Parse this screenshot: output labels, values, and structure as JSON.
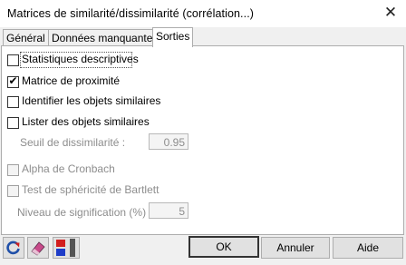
{
  "window": {
    "title": "Matrices de similarité/dissimilarité (corrélation...)",
    "close_glyph": "✕"
  },
  "tabs": [
    {
      "label": "Général",
      "active": false
    },
    {
      "label": "Données manquantes",
      "active": false
    },
    {
      "label": "Sorties",
      "active": true
    }
  ],
  "options": {
    "stats_desc": {
      "label": "Statistiques descriptives",
      "checked": false
    },
    "prox_matrix": {
      "label": "Matrice de proximité",
      "checked": true
    },
    "identify_similar": {
      "label": "Identifier les objets similaires",
      "checked": false
    },
    "list_similar": {
      "label": "Lister des objets similaires",
      "checked": false
    },
    "dissim_threshold": {
      "label": "Seuil de dissimilarité :",
      "value": "0.95"
    },
    "cronbach": {
      "label": "Alpha de Cronbach",
      "checked": false
    },
    "bartlett": {
      "label": "Test de sphéricité de Bartlett",
      "checked": false
    },
    "sig_level": {
      "label": "Niveau de signification (%)",
      "value": "5"
    }
  },
  "buttons": {
    "ok": "OK",
    "cancel": "Annuler",
    "help": "Aide"
  },
  "toolbar_icons": [
    "reset-icon",
    "eraser-icon",
    "selection-toggle-icon"
  ],
  "colors": {
    "selection_red": "#d21e1e",
    "selection_blue": "#1e3cc8",
    "check": "#000000"
  }
}
